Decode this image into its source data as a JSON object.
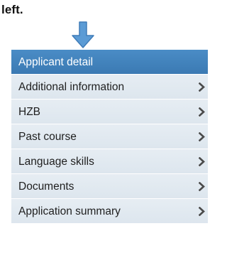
{
  "caption": "left.",
  "colors": {
    "active_bg": "#3f82bd",
    "item_bg": "#e1e9f0",
    "arrow": "#5b9bd5",
    "chevron": "#4a4a4a"
  },
  "icons": {
    "pointer": "down-arrow-icon",
    "item_chevron": "chevron-right-icon"
  },
  "menu": {
    "items": [
      {
        "label": "Applicant detail",
        "active": true
      },
      {
        "label": "Additional information",
        "active": false
      },
      {
        "label": "HZB",
        "active": false
      },
      {
        "label": "Past course",
        "active": false
      },
      {
        "label": "Language skills",
        "active": false
      },
      {
        "label": "Documents",
        "active": false
      },
      {
        "label": "Application summary",
        "active": false
      }
    ]
  }
}
